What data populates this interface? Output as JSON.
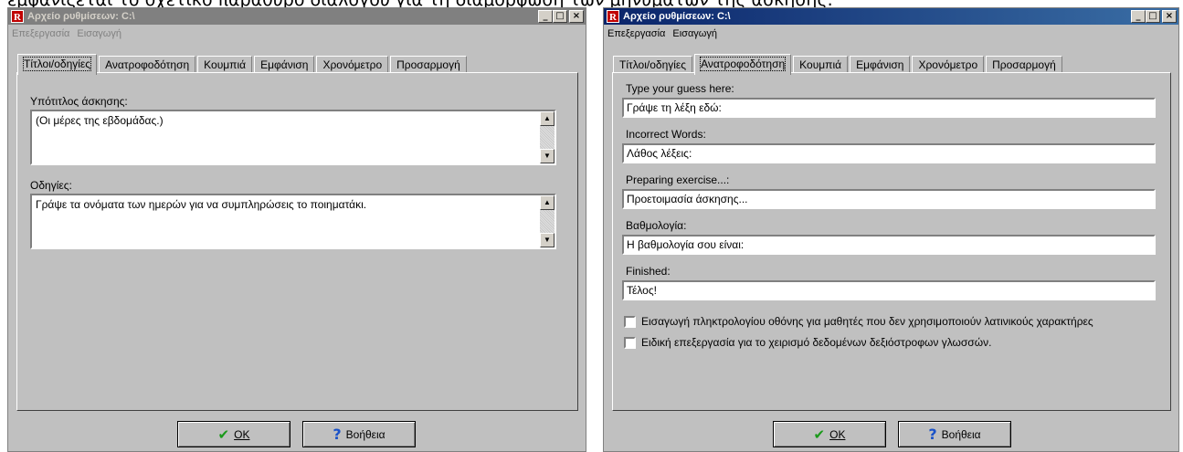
{
  "caption_fragment": "εμφανίζεται το σχετικό παράθυρο διαλόγου για τη διαμόρφωση των μηνυμάτων της άσκησης.",
  "left_window": {
    "title": "Αρχείο ρυθμίσεων: C:\\",
    "menu": [
      "Επεξεργασία",
      "Εισαγωγή"
    ],
    "tabs": [
      "Τίτλοι/οδηγίες",
      "Ανατροφοδότηση",
      "Κουμπιά",
      "Εμφάνιση",
      "Χρονόμετρο",
      "Προσαρμογή"
    ],
    "active_tab": 0,
    "subtitle_label": "Υπότιτλος άσκησης:",
    "subtitle_value": "(Οι μέρες της εβδομάδας.)",
    "instructions_label": "Οδηγίες:",
    "instructions_value": "Γράψε τα ονόματα των ημερών για να συμπληρώσεις το ποιηματάκι.",
    "ok_label": "OK",
    "help_label": "Βοήθεια"
  },
  "right_window": {
    "title": "Αρχείο ρυθμίσεων: C:\\",
    "menu": [
      "Επεξεργασία",
      "Εισαγωγή"
    ],
    "tabs": [
      "Τίτλοι/οδηγίες",
      "Ανατροφοδότηση",
      "Κουμπιά",
      "Εμφάνιση",
      "Χρονόμετρο",
      "Προσαρμογή"
    ],
    "active_tab": 1,
    "fields": [
      {
        "label": "Type your guess here:",
        "value": "Γράψε τη λέξη εδώ:"
      },
      {
        "label": "Incorrect Words:",
        "value": "Λάθος λέξεις:"
      },
      {
        "label": "Preparing exercise...:",
        "value": "Προετοιμασία άσκησης..."
      },
      {
        "label": "Βαθμολογία:",
        "value": "Η βαθμολογία σου είναι:"
      },
      {
        "label": "Finished:",
        "value": "Τέλος!"
      }
    ],
    "checkboxes": [
      {
        "label": "Εισαγωγή πληκτρολογίου οθόνης για μαθητές που δεν χρησιμοποιούν λατινικούς χαρακτήρες",
        "checked": false
      },
      {
        "label": "Ειδική επεξεργασία για το χειρισμό δεδομένων δεξιόστροφων γλωσσών.",
        "checked": false
      }
    ],
    "ok_label": "OK",
    "help_label": "Βοήθεια"
  },
  "icons": {
    "app": "app-logo-icon",
    "ok": "check-icon",
    "help": "question-icon"
  },
  "colors": {
    "active_titlebar": "#0a246a",
    "inactive_titlebar": "#808080",
    "dialog_face": "#c0c0c0",
    "app_icon": "#c00000",
    "ok_check": "#1a9a1a",
    "help_mark": "#1a52c8"
  }
}
